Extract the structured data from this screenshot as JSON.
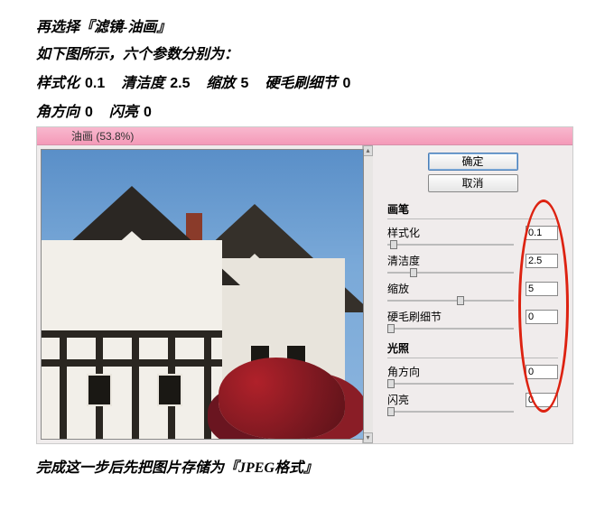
{
  "intro": {
    "line1": "再选择『滤镜-油画』",
    "line2": "如下图所示，六个参数分别为："
  },
  "summary_params": [
    {
      "label": "样式化",
      "value": "0.1"
    },
    {
      "label": "清洁度",
      "value": "2.5"
    },
    {
      "label": "缩放",
      "value": "5"
    },
    {
      "label": "硬毛刷细节",
      "value": "0"
    },
    {
      "label": "角方向",
      "value": "0"
    },
    {
      "label": "闪亮",
      "value": "0"
    }
  ],
  "dialog": {
    "title": "油画 (53.8%)",
    "buttons": {
      "ok": "确定",
      "cancel": "取消"
    },
    "groups": {
      "brush": {
        "title": "画笔",
        "params": {
          "stylization": {
            "label": "样式化",
            "value": "0.1",
            "pos": 2
          },
          "cleanliness": {
            "label": "清洁度",
            "value": "2.5",
            "pos": 18
          },
          "scale": {
            "label": "缩放",
            "value": "5",
            "pos": 55
          },
          "bristle": {
            "label": "硬毛刷细节",
            "value": "0",
            "pos": 0
          }
        }
      },
      "lighting": {
        "title": "光照",
        "params": {
          "angle": {
            "label": "角方向",
            "value": "0",
            "pos": 0
          },
          "shine": {
            "label": "闪亮",
            "value": "0",
            "pos": 0
          }
        }
      }
    }
  },
  "outro": "完成这一步后先把图片存储为『JPEG格式』"
}
